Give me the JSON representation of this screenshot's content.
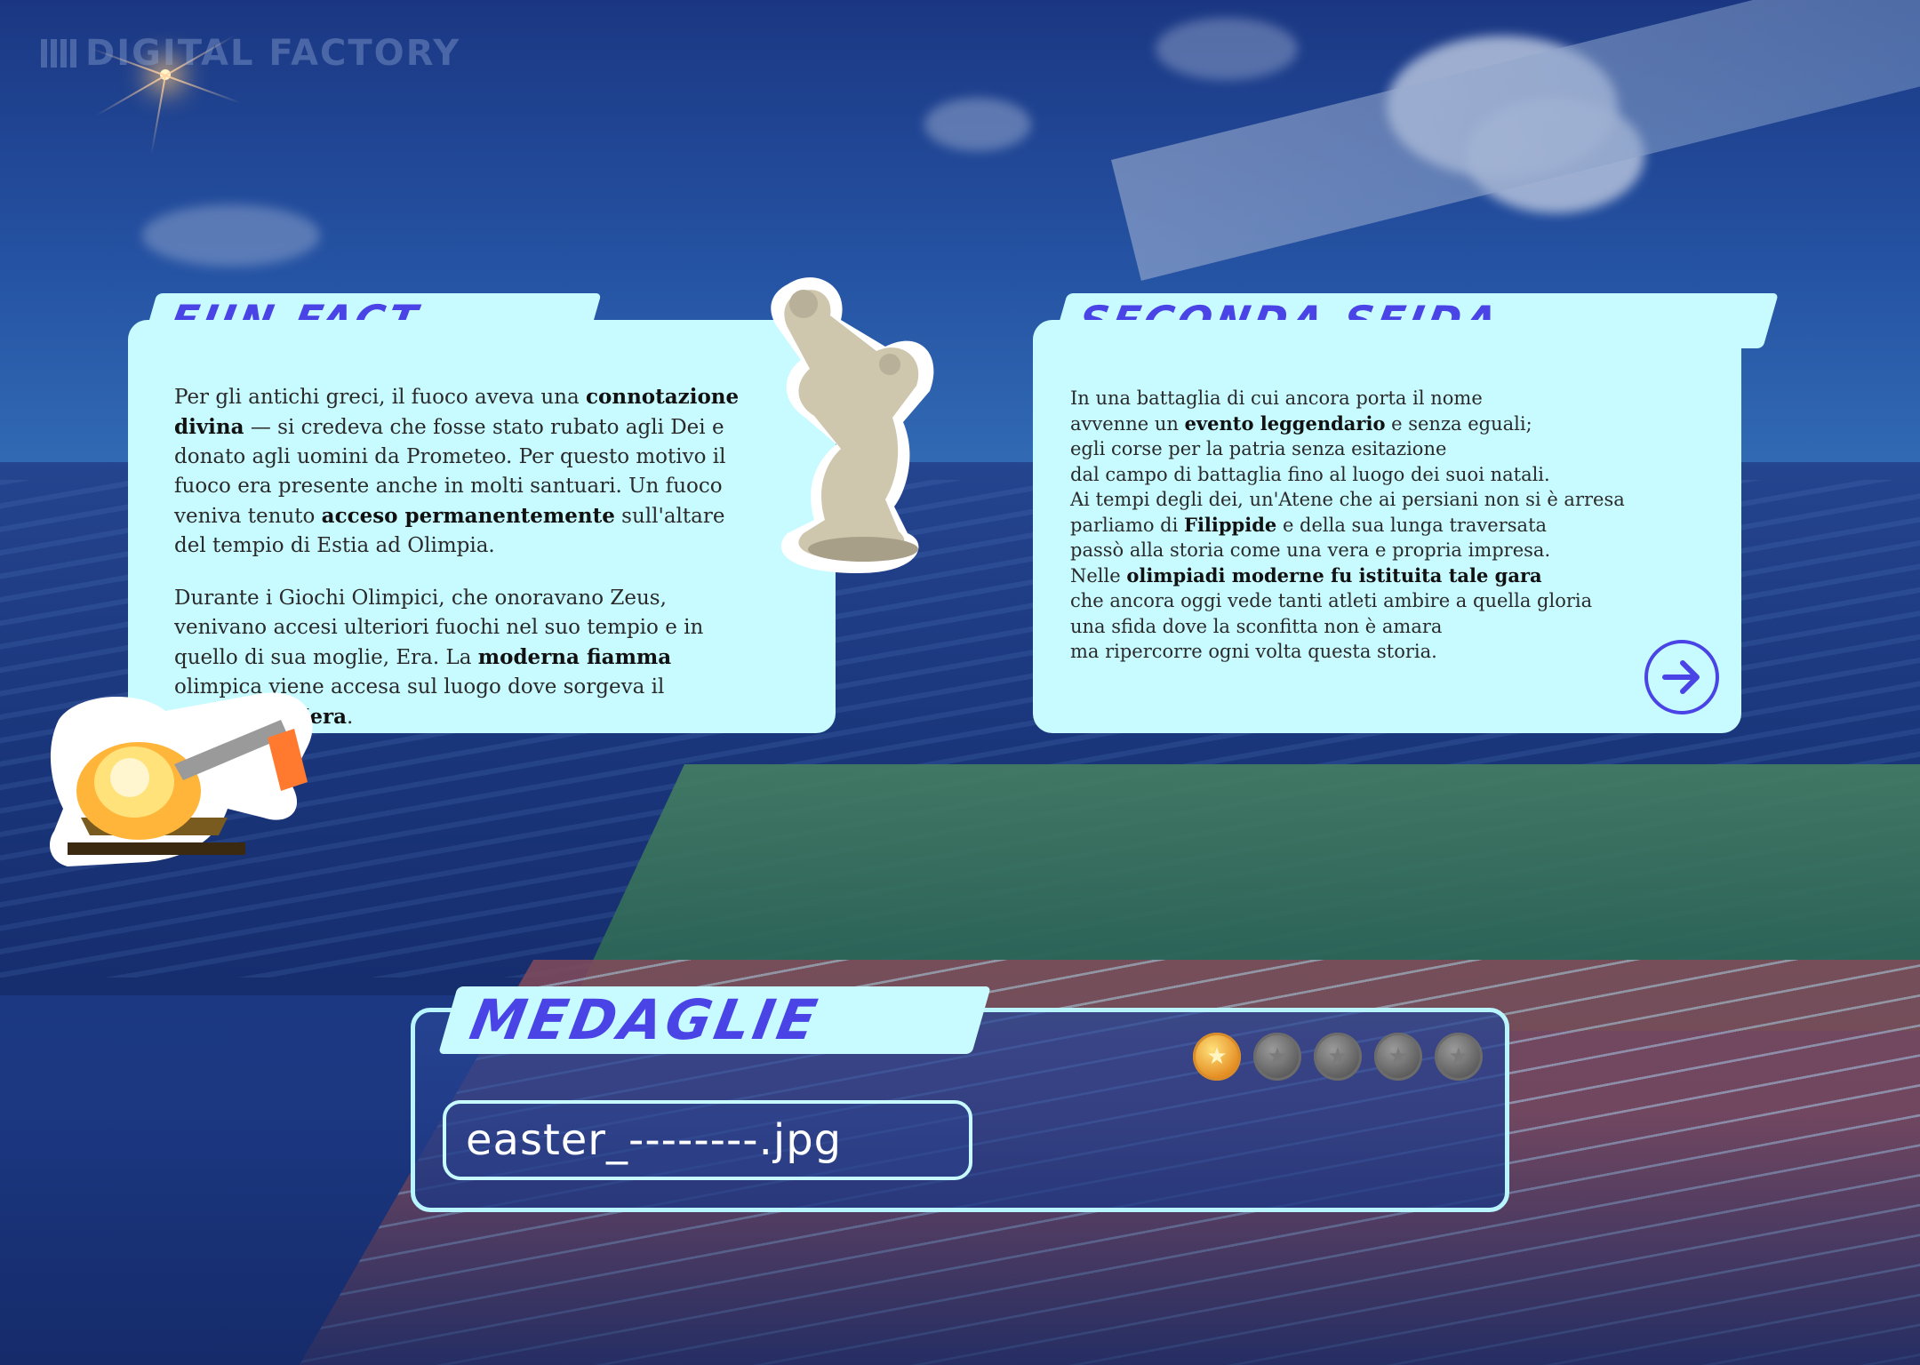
{
  "logo": {
    "text": "DIGITAL FACTORY"
  },
  "fun_fact": {
    "title": "FUN FACT",
    "paragraphs": [
      [
        {
          "t": "Per gli antichi greci, il fuoco aveva una ",
          "b": false
        },
        {
          "t": "connotazione divina",
          "b": true
        },
        {
          "t": " — si credeva che fosse stato rubato agli Dei e donato agli uomini da Prometeo. Per questo motivo il fuoco era presente anche in molti santuari. Un fuoco veniva tenuto ",
          "b": false
        },
        {
          "t": "acceso permanentemente",
          "b": true
        },
        {
          "t": " sull'altare del tempio di Estia ad Olimpia.",
          "b": false
        }
      ],
      [
        {
          "t": "Durante i Giochi Olimpici, che onoravano Zeus, venivano accesi ulteriori fuochi nel suo tempio e in quello di sua moglie, Era. La ",
          "b": false
        },
        {
          "t": "moderna fiamma",
          "b": true
        },
        {
          "t": " olimpica viene accesa sul luogo dove sorgeva il ",
          "b": false
        },
        {
          "t": "tempio di Hera",
          "b": true
        },
        {
          "t": ".",
          "b": false
        }
      ]
    ]
  },
  "seconda_sfida": {
    "title": "SECONDA SFIDA",
    "lines": [
      [
        {
          "t": "In una battaglia di cui ancora porta il nome",
          "b": false
        }
      ],
      [
        {
          "t": "avvenne un ",
          "b": false
        },
        {
          "t": "evento leggendario",
          "b": true
        },
        {
          "t": " e senza eguali;",
          "b": false
        }
      ],
      [
        {
          "t": "egli corse per la patria senza esitazione",
          "b": false
        }
      ],
      [
        {
          "t": "dal campo di battaglia fino al luogo dei suoi natali.",
          "b": false
        }
      ],
      [
        {
          "t": "Ai tempi degli dei, un'Atene che ai persiani non si è arresa",
          "b": false
        }
      ],
      [
        {
          "t": "parliamo di ",
          "b": false
        },
        {
          "t": "Filippide",
          "b": true
        },
        {
          "t": " e della sua lunga traversata",
          "b": false
        }
      ],
      [
        {
          "t": "passò alla storia come una vera e propria impresa.",
          "b": false
        }
      ],
      [
        {
          "t": "Nelle ",
          "b": false
        },
        {
          "t": "olimpiadi moderne fu istituita tale gara",
          "b": true
        }
      ],
      [
        {
          "t": "che ancora oggi vede tanti atleti ambire a quella gloria",
          "b": false
        }
      ],
      [
        {
          "t": "una sfida dove la sconfitta non è amara",
          "b": false
        }
      ],
      [
        {
          "t": "ma ripercorre ogni volta questa storia.",
          "b": false
        }
      ]
    ],
    "next_icon": "arrow-right-icon"
  },
  "medaglie": {
    "title": "MEDAGLIE",
    "medals": [
      {
        "earned": true,
        "color": "#e38a1f"
      },
      {
        "earned": false,
        "color": "#5b5b5b"
      },
      {
        "earned": false,
        "color": "#5b5b5b"
      },
      {
        "earned": false,
        "color": "#5b5b5b"
      },
      {
        "earned": false,
        "color": "#5b5b5b"
      }
    ],
    "filename": "easter_--------.jpg"
  },
  "colors": {
    "panel": "#c7fbff",
    "accent": "#4a43e6",
    "text": "#2a2a2a"
  }
}
